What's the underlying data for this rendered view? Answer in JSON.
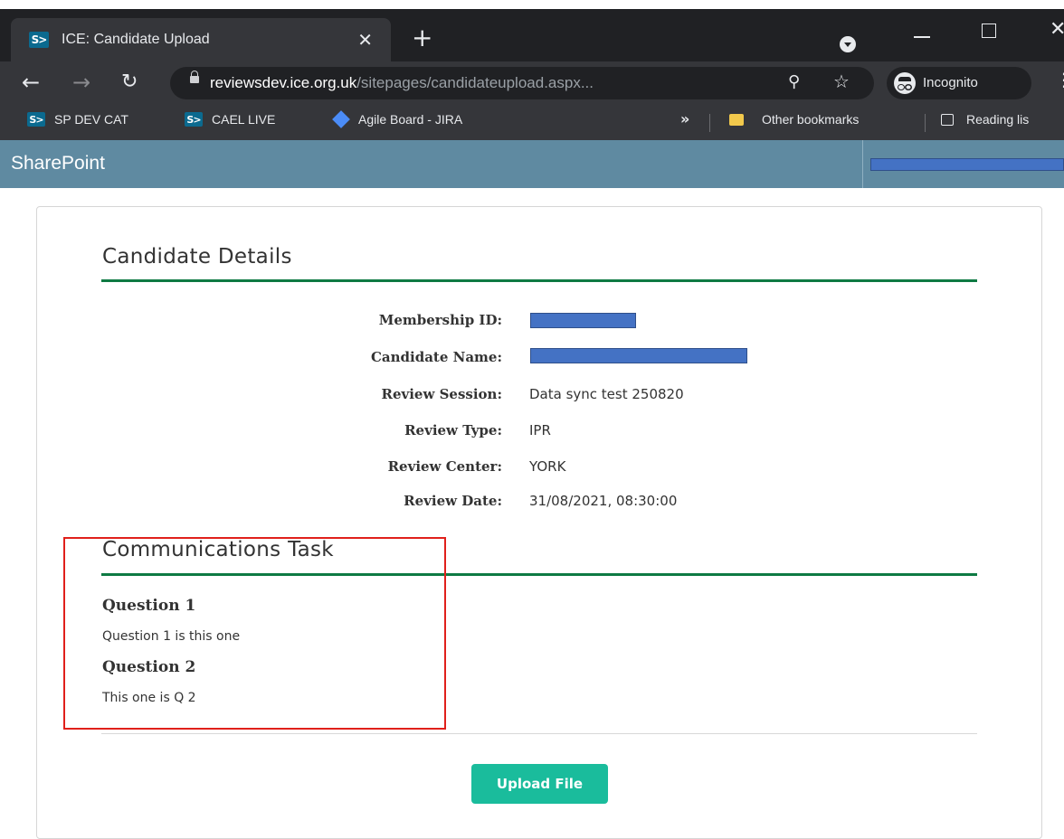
{
  "browser": {
    "tab": {
      "title": "ICE: Candidate Upload",
      "favicon_text": "S>",
      "close_glyph": "✕"
    },
    "new_tab_glyph": "+",
    "address": {
      "host": "reviewsdev.ice.org.uk",
      "path": "/sitepages/candidateupload.aspx..."
    },
    "incognito_label": "Incognito",
    "icons": {
      "back": "arrow-left",
      "forward": "arrow-right",
      "reload": "reload",
      "zoom": "zoom",
      "star": "star",
      "menu": "more-vertical"
    },
    "bookmarks": [
      {
        "label": "SP DEV CAT",
        "icon": "sharepoint"
      },
      {
        "label": "CAEL LIVE",
        "icon": "sharepoint"
      },
      {
        "label": "Agile Board - JIRA",
        "icon": "jira"
      }
    ],
    "overflow_glyph": "»",
    "other_bookmarks": "Other bookmarks",
    "reading_list": "Reading lis"
  },
  "sharepoint": {
    "title": "SharePoint"
  },
  "candidate_details": {
    "title": "Candidate Details",
    "fields": [
      {
        "label": "Membership ID:",
        "value": "",
        "redacted": true
      },
      {
        "label": "Candidate Name:",
        "value": "",
        "redacted": true
      },
      {
        "label": "Review Session:",
        "value": "Data sync test 250820"
      },
      {
        "label": "Review Type:",
        "value": "IPR"
      },
      {
        "label": "Review Center:",
        "value": "YORK"
      },
      {
        "label": "Review Date:",
        "value": "31/08/2021, 08:30:00"
      }
    ]
  },
  "communications_task": {
    "title": "Communications Task",
    "questions": [
      {
        "title": "Question 1",
        "text": "Question 1 is this one"
      },
      {
        "title": "Question 2",
        "text": "This one is Q 2"
      }
    ]
  },
  "upload_button": "Upload File",
  "colors": {
    "sharepoint_bar": "#5f8aa1",
    "rule_green": "#0e7a43",
    "upload_button": "#1abc9c",
    "redaction": "#4472c4",
    "highlight_red": "#e0201b"
  }
}
